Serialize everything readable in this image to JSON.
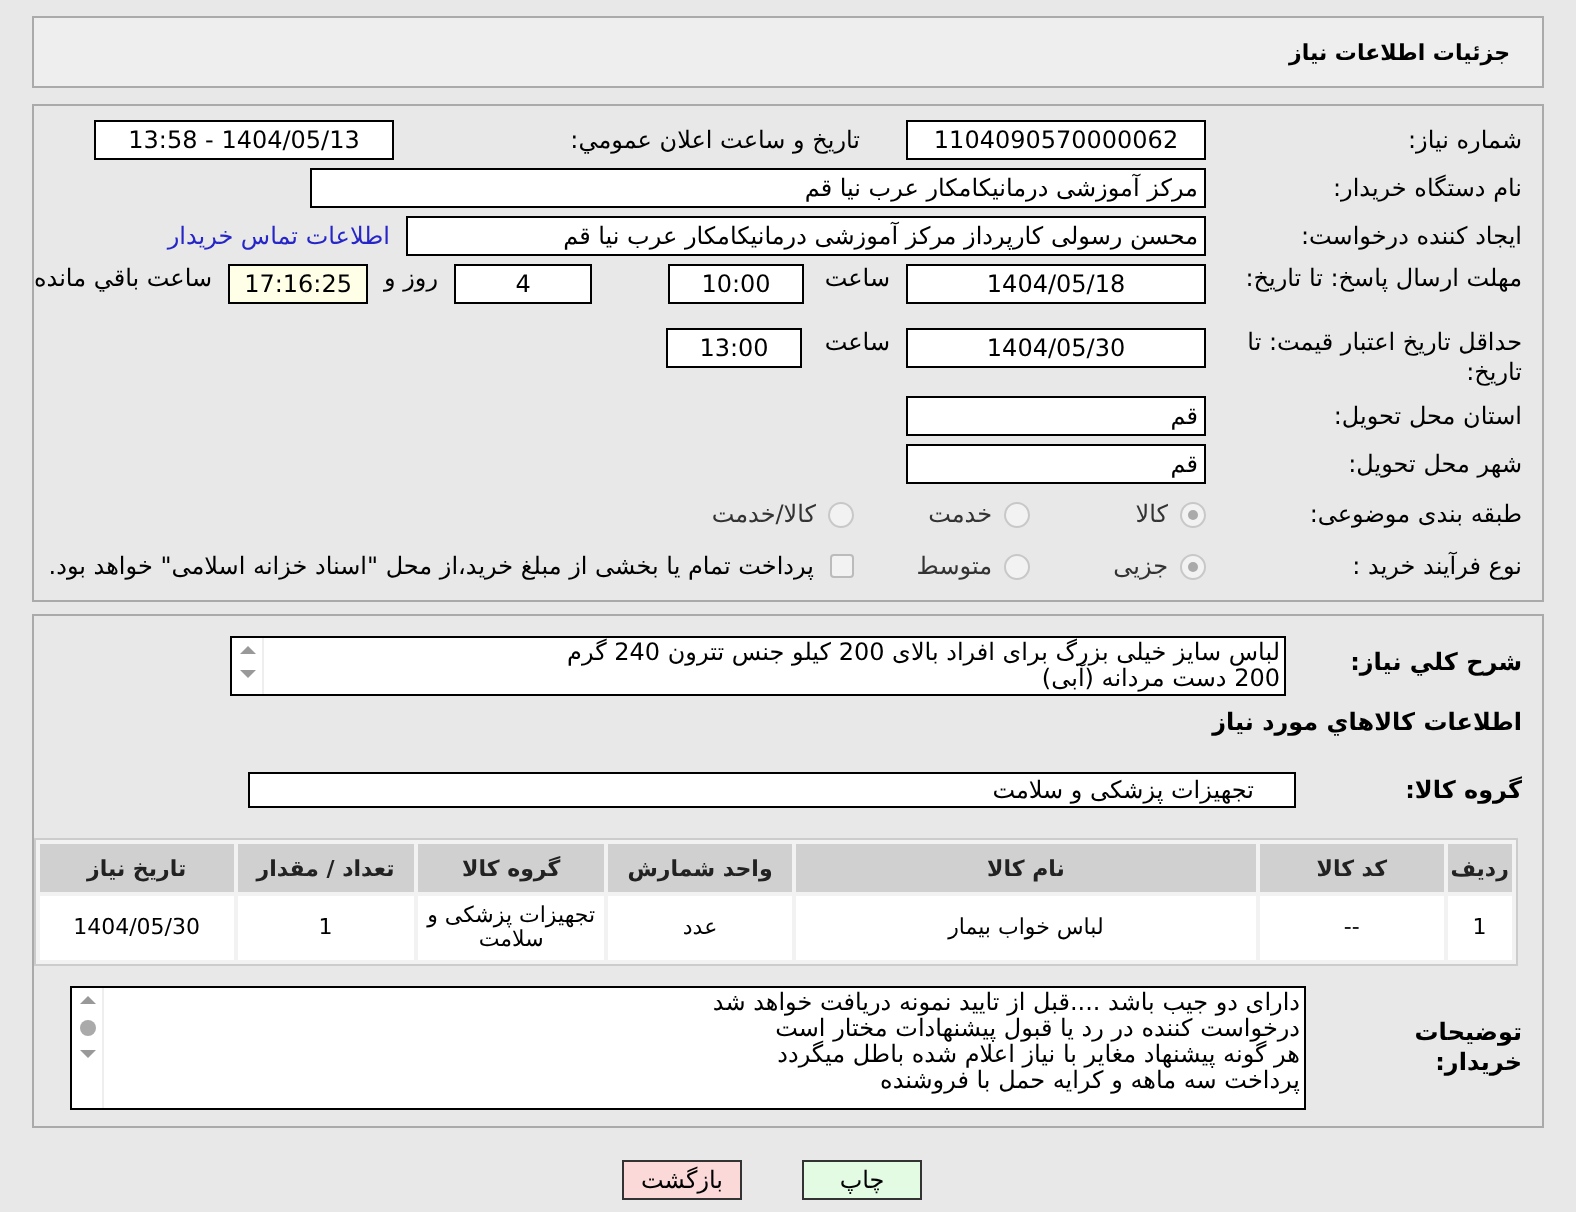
{
  "header": {
    "title": "جزئیات اطلاعات نیاز"
  },
  "fields": {
    "need_number": {
      "label": "شماره نیاز:",
      "value": "1104090570000062"
    },
    "announce": {
      "label": "تاریخ و ساعت اعلان عمومي:",
      "value": "1404/05/13 - 13:58"
    },
    "buyer_org": {
      "label": "نام دستگاه خریدار:",
      "value": "مرکز آموزشی درمانیکامکار عرب نیا قم"
    },
    "creator": {
      "label": "ایجاد کننده درخواست:",
      "value": "محسن رسولی کارپرداز مرکز آموزشی درمانیکامکار عرب نیا قم",
      "link": "اطلاعات تماس خریدار"
    },
    "reply_deadline": {
      "label": "مهلت ارسال پاسخ: تا تاریخ:",
      "date": "1404/05/18",
      "time_label": "ساعت",
      "time": "10:00",
      "days": "4",
      "days_label": "روز و",
      "remaining": "17:16:25",
      "remaining_label": "ساعت باقي مانده"
    },
    "price_validity": {
      "label": "حداقل تاریخ اعتبار قیمت: تا تاریخ:",
      "date": "1404/05/30",
      "time_label": "ساعت",
      "time": "13:00"
    },
    "province": {
      "label": "استان محل تحویل:",
      "value": "قم"
    },
    "city": {
      "label": "شهر محل تحویل:",
      "value": "قم"
    },
    "category": {
      "label": "طبقه بندی موضوعی:",
      "options": [
        {
          "label": "کالا",
          "selected": true
        },
        {
          "label": "خدمت",
          "selected": false
        },
        {
          "label": "کالا/خدمت",
          "selected": false
        }
      ]
    },
    "process": {
      "label": "نوع فرآیند خرید :",
      "options": [
        {
          "label": "جزیی",
          "selected": true
        },
        {
          "label": "متوسط",
          "selected": false
        }
      ],
      "treasury": {
        "checked": false,
        "label": "پرداخت تمام یا بخشی از مبلغ خرید،از محل \"اسناد خزانه اسلامی\" خواهد بود."
      }
    }
  },
  "description": {
    "label": "شرح كلي نياز:",
    "lines": [
      "لباس سایز خیلی بزرگ برای افراد بالای 200 کیلو جنس تترون 240 گرم",
      "200 دست مردانه (آبی)"
    ]
  },
  "goods_heading": "اطلاعات كالاهاي مورد نياز",
  "goods_group": {
    "label": "گروه کالا:",
    "value": "تجهیزات پزشکی و سلامت"
  },
  "table": {
    "columns": [
      "رديف",
      "کد کالا",
      "نام کالا",
      "واحد شمارش",
      "گروه کالا",
      "تعداد / مقدار",
      "تاریخ نیاز"
    ],
    "rows": [
      [
        "1",
        "--",
        "لباس خواب بیمار",
        "عدد",
        "تجهیزات پزشکی و سلامت",
        "1",
        "1404/05/30"
      ]
    ]
  },
  "buyer_notes": {
    "label": "توضیحات خریدار:",
    "lines": [
      "دارای دو جیب باشد ....قبل از تایید نمونه دریافت خواهد شد",
      "درخواست کننده در رد یا قبول پیشنهادات  مختار است",
      "هر گونه پیشنهاد مغایر با نیاز اعلام شده باطل میگردد",
      "پرداخت سه ماهه و کرایه حمل با فروشنده"
    ]
  },
  "buttons": [
    {
      "label": "چاپ",
      "kind": "print"
    },
    {
      "label": "بازگشت",
      "kind": "back"
    }
  ]
}
